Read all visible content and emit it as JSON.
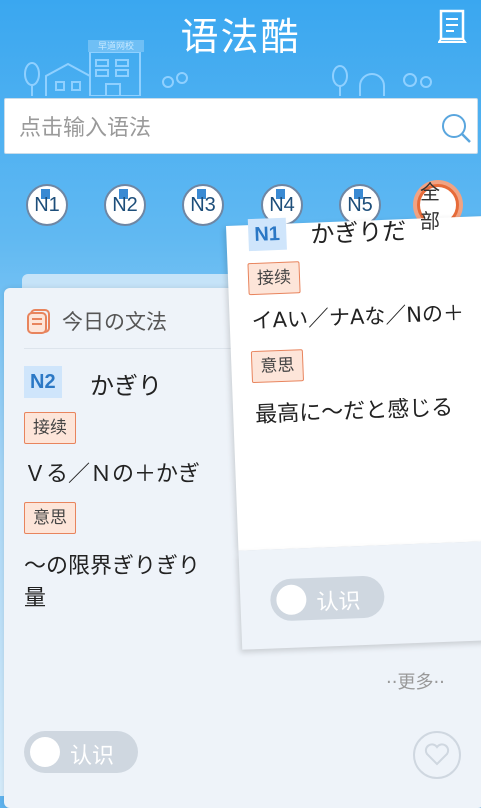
{
  "app": {
    "title": "语法酷"
  },
  "search": {
    "placeholder": "点击输入语法"
  },
  "town": {
    "sign": "早道网校"
  },
  "levels": [
    {
      "label": "N1"
    },
    {
      "label": "N2"
    },
    {
      "label": "N3"
    },
    {
      "label": "N4"
    },
    {
      "label": "N5"
    },
    {
      "label": "全部",
      "selected": true
    }
  ],
  "back_card": {
    "section_title": "今日の文法",
    "level": "N2",
    "grammar": "かぎり",
    "connection_label": "接续",
    "connection": "Ｖる／Ｎの＋かぎ",
    "meaning_label": "意思",
    "meaning_line1": "～の限界ぎりぎり",
    "meaning_line2": "量",
    "known_toggle": "认识",
    "more": "··更多··"
  },
  "front_card": {
    "level": "N1",
    "grammar": "かぎりだ",
    "connection_label": "接续",
    "connection": "イAい／ナAな／Nの＋",
    "meaning_label": "意思",
    "meaning": "最高に～だと感じる",
    "known_toggle": "认识"
  },
  "colors": {
    "accent": "#3aa7f0",
    "badge_border": "#e8845d",
    "level_tag": "#2b78c5"
  }
}
